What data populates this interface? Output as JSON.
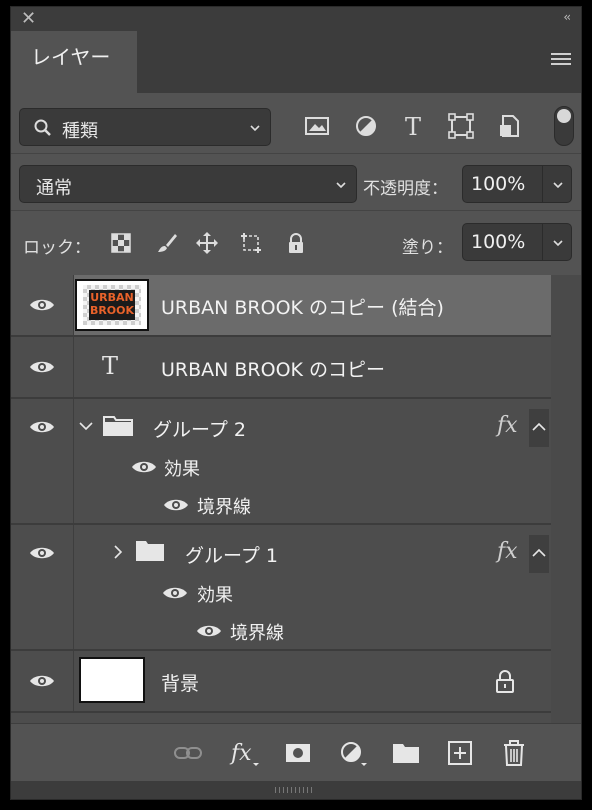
{
  "window": {
    "close_glyph": "✕",
    "collapse_glyph": "‹‹"
  },
  "tab": {
    "label": "レイヤー"
  },
  "filter": {
    "label": "種類",
    "icons": [
      "image-filter-icon",
      "adjustment-filter-icon",
      "type-filter-icon",
      "shape-filter-icon",
      "smart-object-filter-icon"
    ]
  },
  "blend": {
    "mode": "通常",
    "opacity_label": "不透明度：",
    "opacity": "100%"
  },
  "lock": {
    "label": "ロック：",
    "fill_label": "塗り：",
    "fill": "100%"
  },
  "layers": [
    {
      "name": "URBAN BROOK のコピー (結合)",
      "type": "smart",
      "selected": true,
      "thumb_text": "URBAN\nBROOK"
    },
    {
      "name": "URBAN BROOK のコピー",
      "type": "text",
      "type_glyph": "T"
    },
    {
      "name": "グループ 2",
      "type": "group",
      "fx": "fx",
      "effects_label": "効果",
      "effect": "境界線"
    },
    {
      "name": "グループ 1",
      "type": "group",
      "fx": "fx",
      "effects_label": "効果",
      "effect": "境界線"
    },
    {
      "name": "背景",
      "type": "background"
    }
  ],
  "colors": {
    "panel": "#535353",
    "selected": "#6b6b6b",
    "thumb_orange": "#e8622a"
  }
}
